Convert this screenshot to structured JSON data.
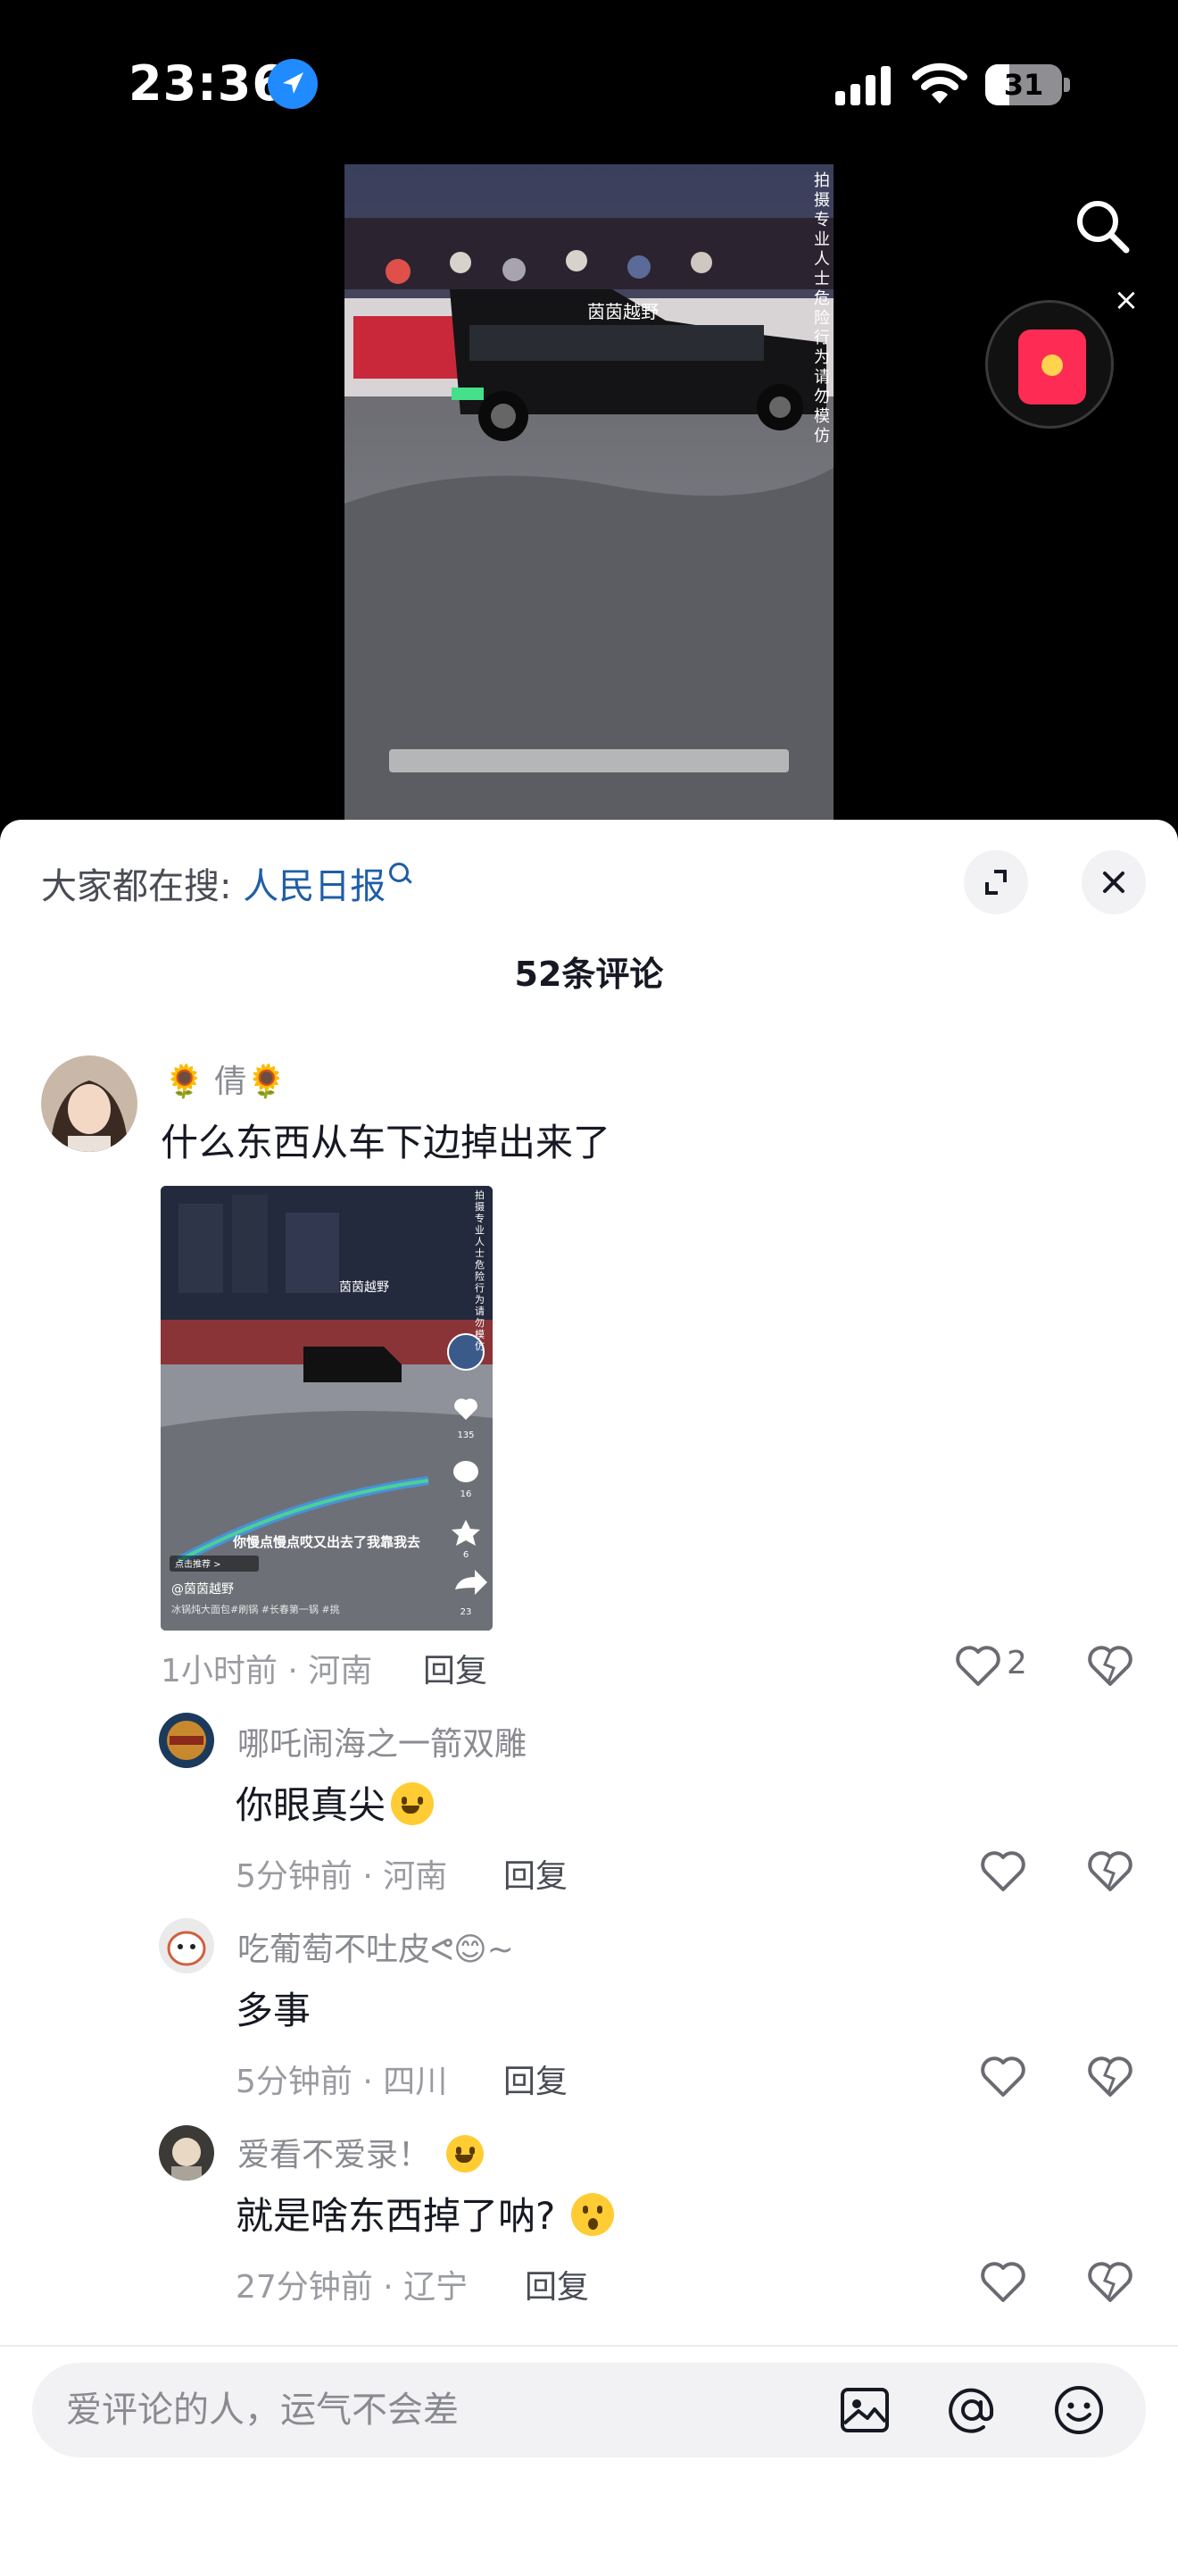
{
  "status": {
    "time": "23:36",
    "battery": "31",
    "battery_level": 0.31
  },
  "video": {
    "channel_watermark": "茵茵越野",
    "vertical_warning": "拍摄专业人士 危险行为 请勿模仿"
  },
  "panel": {
    "hot_search_label": "大家都在搜:",
    "hot_search_keyword": "人民日报",
    "comment_count": "52条评论"
  },
  "comments": [
    {
      "user": "🌻 倩🌻",
      "text": "什么东西从车下边掉出来了",
      "meta": "1小时前 · 河南",
      "reply": "回复",
      "likes": "2",
      "image": {
        "caption": "你慢点慢点哎又出去了我靠我去",
        "recommend": "点击推荐 >",
        "author": "@茵茵越野",
        "tags": "冰锅炖大面包#刷锅 #长春第一锅 #挑",
        "watermark": "茵茵越野",
        "side_text": "拍摄专业人士 危险行为 请勿模仿",
        "like_count": "135",
        "comment_count": "16",
        "fav_count": "6",
        "share_count": "23"
      }
    },
    {
      "user": "哪吒闹海之一箭双雕",
      "text": "你眼真尖",
      "meta": "5分钟前 · 河南",
      "reply": "回复"
    },
    {
      "user": "吃葡萄不吐皮ᕙ😊~",
      "text": "多事",
      "meta": "5分钟前 · 四川",
      "reply": "回复"
    },
    {
      "user": "爱看不爱录！",
      "text": "就是啥东西掉了呐?",
      "meta": "27分钟前 · 辽宁",
      "reply": "回复"
    }
  ],
  "input": {
    "placeholder": "爱评论的人，运气不会差"
  },
  "colors": {
    "accent": "#fe2c55",
    "link": "#1f5ea8",
    "text_primary": "#161823",
    "text_secondary": "#8a8b91"
  },
  "icons": [
    "location-arrow-icon",
    "signal-icon",
    "wifi-icon",
    "battery-icon",
    "search-icon",
    "red-packet-icon",
    "close-icon",
    "expand-icon",
    "heart-icon",
    "dislike-icon",
    "image-icon",
    "at-icon",
    "emoji-icon"
  ]
}
